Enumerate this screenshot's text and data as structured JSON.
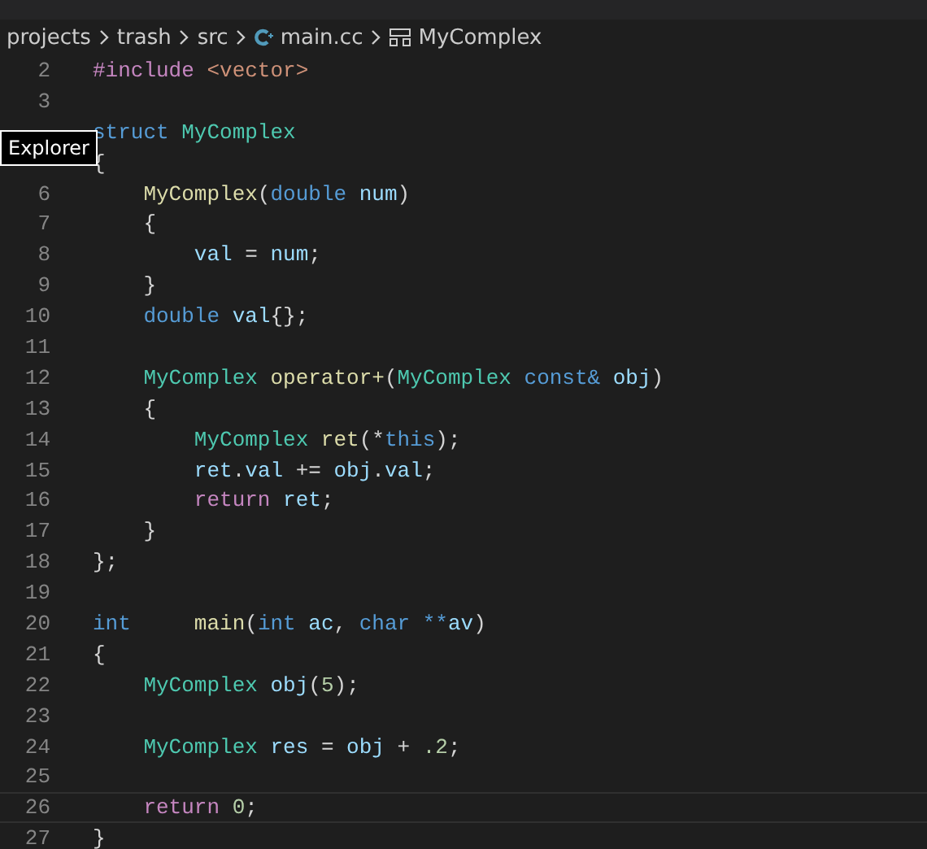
{
  "breadcrumb": [
    {
      "label": "projects",
      "kind": "folder"
    },
    {
      "label": "trash",
      "kind": "folder"
    },
    {
      "label": "src",
      "kind": "folder"
    },
    {
      "label": "main.cc",
      "kind": "file"
    },
    {
      "label": "MyComplex",
      "kind": "symbol"
    }
  ],
  "tooltip": "Explorer",
  "lines": [
    {
      "number": "2",
      "current": false,
      "tokens": [
        {
          "kind": "preproc",
          "text": "#include"
        },
        {
          "kind": "string",
          "text": " <vector>"
        }
      ]
    },
    {
      "number": "3",
      "current": false
    },
    {
      "current": false,
      "tokens": [
        {
          "kind": "keyword",
          "text": "struct"
        },
        {
          "kind": "type",
          "text": " MyComplex"
        }
      ]
    },
    {
      "current": false,
      "tokens": [
        {
          "kind": "punct",
          "text": "{"
        }
      ]
    },
    {
      "number": "6",
      "current": false,
      "tokens": [
        {
          "kind": "func",
          "text": "    MyComplex"
        },
        {
          "kind": "punct",
          "text": "("
        },
        {
          "kind": "keyword",
          "text": "double"
        },
        {
          "kind": "var",
          "text": " num"
        },
        {
          "kind": "punct",
          "text": ")"
        }
      ]
    },
    {
      "number": "7",
      "current": false,
      "tokens": [
        {
          "kind": "punct",
          "text": "    {"
        }
      ]
    },
    {
      "number": "8",
      "current": false,
      "tokens": [
        {
          "kind": "var",
          "text": "        val"
        },
        {
          "kind": "punct",
          "text": " ="
        },
        {
          "kind": "var",
          "text": " num"
        },
        {
          "kind": "punct",
          "text": ";"
        }
      ]
    },
    {
      "number": "9",
      "current": false,
      "tokens": [
        {
          "kind": "punct",
          "text": "    }"
        }
      ]
    },
    {
      "number": "10",
      "current": false,
      "tokens": [
        {
          "kind": "keyword",
          "text": "    double"
        },
        {
          "kind": "var",
          "text": " val"
        },
        {
          "kind": "punct",
          "text": "{};"
        }
      ]
    },
    {
      "number": "11",
      "current": false
    },
    {
      "number": "12",
      "current": false,
      "tokens": [
        {
          "kind": "type",
          "text": "    MyComplex"
        },
        {
          "kind": "func",
          "text": " operator+"
        },
        {
          "kind": "punct",
          "text": "("
        },
        {
          "kind": "type",
          "text": "MyComplex"
        },
        {
          "kind": "keyword",
          "text": " const&"
        },
        {
          "kind": "var",
          "text": " obj"
        },
        {
          "kind": "punct",
          "text": ")"
        }
      ]
    },
    {
      "number": "13",
      "current": false,
      "tokens": [
        {
          "kind": "punct",
          "text": "    {"
        }
      ]
    },
    {
      "number": "14",
      "current": false,
      "tokens": [
        {
          "kind": "type",
          "text": "        MyComplex"
        },
        {
          "kind": "func",
          "text": " ret"
        },
        {
          "kind": "punct",
          "text": "(*"
        },
        {
          "kind": "keyword",
          "text": "this"
        },
        {
          "kind": "punct",
          "text": ");"
        }
      ]
    },
    {
      "number": "15",
      "current": false,
      "tokens": [
        {
          "kind": "var",
          "text": "        ret"
        },
        {
          "kind": "punct",
          "text": "."
        },
        {
          "kind": "var",
          "text": "val"
        },
        {
          "kind": "punct",
          "text": " +="
        },
        {
          "kind": "var",
          "text": " obj"
        },
        {
          "kind": "punct",
          "text": "."
        },
        {
          "kind": "var",
          "text": "val"
        },
        {
          "kind": "punct",
          "text": ";"
        }
      ]
    },
    {
      "number": "16",
      "current": false,
      "tokens": [
        {
          "kind": "control",
          "text": "        return"
        },
        {
          "kind": "var",
          "text": " ret"
        },
        {
          "kind": "punct",
          "text": ";"
        }
      ]
    },
    {
      "number": "17",
      "current": false,
      "tokens": [
        {
          "kind": "punct",
          "text": "    }"
        }
      ]
    },
    {
      "number": "18",
      "current": false,
      "tokens": [
        {
          "kind": "punct",
          "text": "};"
        }
      ]
    },
    {
      "number": "19",
      "current": false
    },
    {
      "number": "20",
      "current": false,
      "tokens": [
        {
          "kind": "keyword",
          "text": "int"
        },
        {
          "kind": "func",
          "text": "     main"
        },
        {
          "kind": "punct",
          "text": "("
        },
        {
          "kind": "keyword",
          "text": "int"
        },
        {
          "kind": "var",
          "text": " ac"
        },
        {
          "kind": "punct",
          "text": ","
        },
        {
          "kind": "keyword",
          "text": " char"
        },
        {
          "kind": "keyword",
          "text": " **"
        },
        {
          "kind": "var",
          "text": "av"
        },
        {
          "kind": "punct",
          "text": ")"
        }
      ]
    },
    {
      "number": "21",
      "current": false,
      "tokens": [
        {
          "kind": "punct",
          "text": "{"
        }
      ]
    },
    {
      "number": "22",
      "current": false,
      "tokens": [
        {
          "kind": "type",
          "text": "    MyComplex"
        },
        {
          "kind": "var",
          "text": " obj"
        },
        {
          "kind": "punct",
          "text": "("
        },
        {
          "kind": "num",
          "text": "5"
        },
        {
          "kind": "punct",
          "text": ");"
        }
      ]
    },
    {
      "number": "23",
      "current": false
    },
    {
      "number": "24",
      "current": false,
      "tokens": [
        {
          "kind": "type",
          "text": "    MyComplex"
        },
        {
          "kind": "var",
          "text": " res"
        },
        {
          "kind": "punct",
          "text": " ="
        },
        {
          "kind": "var",
          "text": " obj"
        },
        {
          "kind": "punct",
          "text": " +"
        },
        {
          "kind": "num",
          "text": " .2"
        },
        {
          "kind": "punct",
          "text": ";"
        }
      ]
    },
    {
      "number": "25",
      "current": false
    },
    {
      "number": "26",
      "current": true,
      "tokens": [
        {
          "kind": "control",
          "text": "    return"
        },
        {
          "kind": "num",
          "text": " 0"
        },
        {
          "kind": "punct",
          "text": ";"
        }
      ]
    },
    {
      "number": "27",
      "current": false,
      "tokens": [
        {
          "kind": "punct",
          "text": "}"
        }
      ]
    }
  ]
}
